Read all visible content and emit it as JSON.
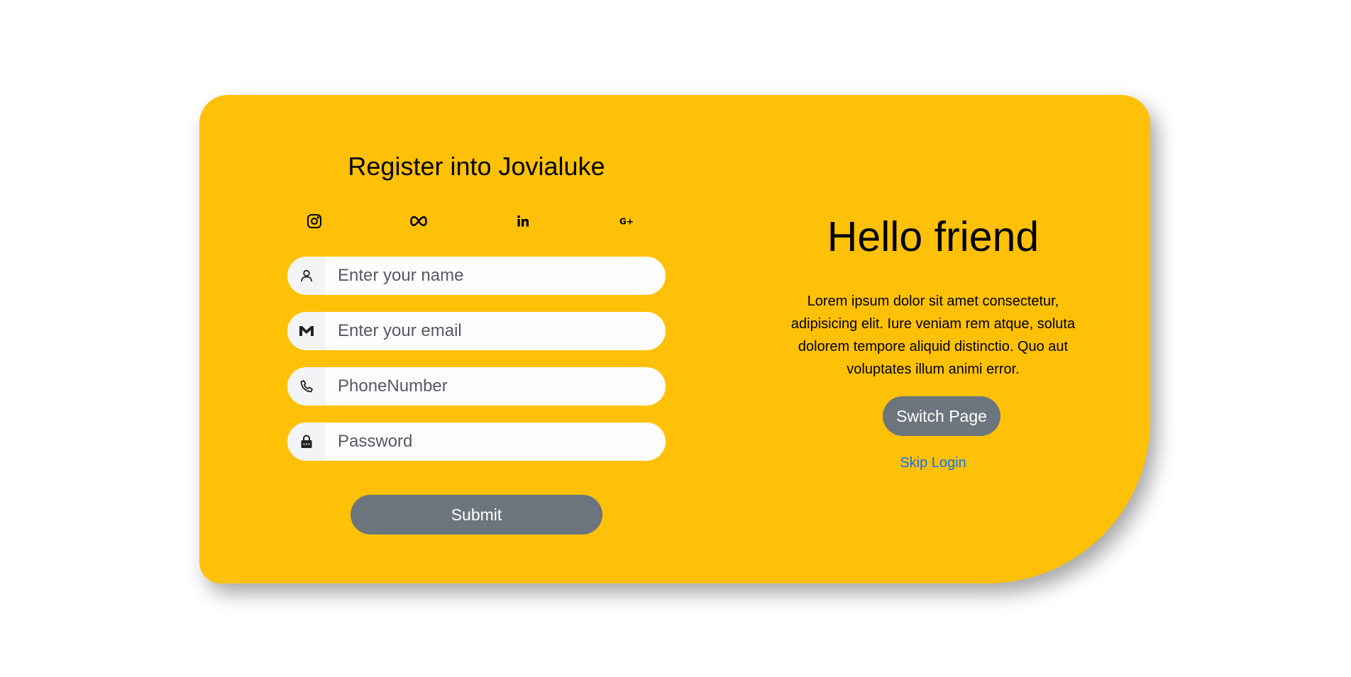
{
  "register": {
    "title": "Register into Jovialuke",
    "socials": [
      {
        "icon": "instagram-icon"
      },
      {
        "icon": "meta-icon"
      },
      {
        "icon": "linkedin-icon"
      },
      {
        "icon": "google-plus-icon"
      }
    ],
    "fields": {
      "name": {
        "placeholder": "Enter your name",
        "value": "",
        "icon": "user-icon"
      },
      "email": {
        "placeholder": "Enter your email",
        "value": "",
        "icon": "gmail-icon"
      },
      "phone": {
        "placeholder": "PhoneNumber",
        "value": "",
        "icon": "phone-icon"
      },
      "password": {
        "placeholder": "Password",
        "value": "",
        "icon": "lock-icon"
      }
    },
    "submit_label": "Submit"
  },
  "welcome": {
    "heading": "Hello friend",
    "body": "Lorem ipsum dolor sit amet consectetur, adipisicing elit. Iure veniam rem atque, soluta dolorem tempore aliquid distinctio. Quo aut voluptates illum animi error.",
    "switch_label": "Switch Page",
    "skip_label": "Skip Login"
  },
  "colors": {
    "card": "#ffc107",
    "button": "#6c757d",
    "link": "#0d6efd",
    "background": "#ffffff"
  }
}
